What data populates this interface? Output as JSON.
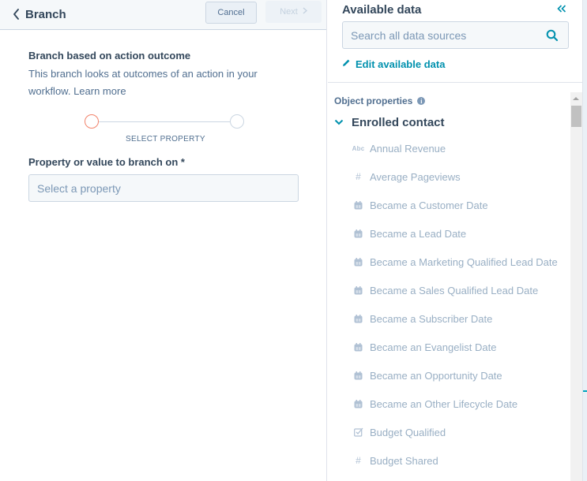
{
  "left_panel": {
    "header": {
      "back_icon": "chevron-left-icon",
      "title": "Branch",
      "cancel_label": "Cancel",
      "next_label": "Next",
      "next_icon": "chevron-right-icon"
    },
    "section_title": "Branch based on action outcome",
    "section_description": "This branch looks at outcomes of an action in your workflow. Learn more",
    "stepper": {
      "steps": 2,
      "current_step": 1,
      "step_label": "SELECT PROPERTY"
    },
    "field": {
      "label": "Property or value to branch on *",
      "placeholder": "Select a property"
    }
  },
  "right_panel": {
    "title": "Available data",
    "collapse_icon": "double-chevron-left-icon",
    "search": {
      "placeholder": "Search all data sources",
      "icon": "search-icon"
    },
    "edit_link": {
      "label": "Edit available data",
      "icon": "pencil-icon"
    },
    "object_properties_label": "Object properties",
    "group": {
      "label": "Enrolled contact",
      "expanded": true
    },
    "properties": [
      {
        "type": "text",
        "icon": "Abc",
        "label": "Annual Revenue"
      },
      {
        "type": "number",
        "icon": "#",
        "label": "Average Pageviews"
      },
      {
        "type": "date",
        "icon": "calendar",
        "label": "Became a Customer Date"
      },
      {
        "type": "date",
        "icon": "calendar",
        "label": "Became a Lead Date"
      },
      {
        "type": "date",
        "icon": "calendar",
        "label": "Became a Marketing Qualified Lead Date"
      },
      {
        "type": "date",
        "icon": "calendar",
        "label": "Became a Sales Qualified Lead Date"
      },
      {
        "type": "date",
        "icon": "calendar",
        "label": "Became a Subscriber Date"
      },
      {
        "type": "date",
        "icon": "calendar",
        "label": "Became an Evangelist Date"
      },
      {
        "type": "date",
        "icon": "calendar",
        "label": "Became an Opportunity Date"
      },
      {
        "type": "date",
        "icon": "calendar",
        "label": "Became an Other Lifecycle Date"
      },
      {
        "type": "checkbox",
        "icon": "checkbox",
        "label": "Budget Qualified"
      },
      {
        "type": "number",
        "icon": "#",
        "label": "Budget Shared"
      }
    ]
  },
  "colors": {
    "accent": "#0091ae",
    "text_primary": "#33475b",
    "text_secondary": "#516f90",
    "step_active": "#f2836b",
    "border": "#cbd6e2"
  }
}
